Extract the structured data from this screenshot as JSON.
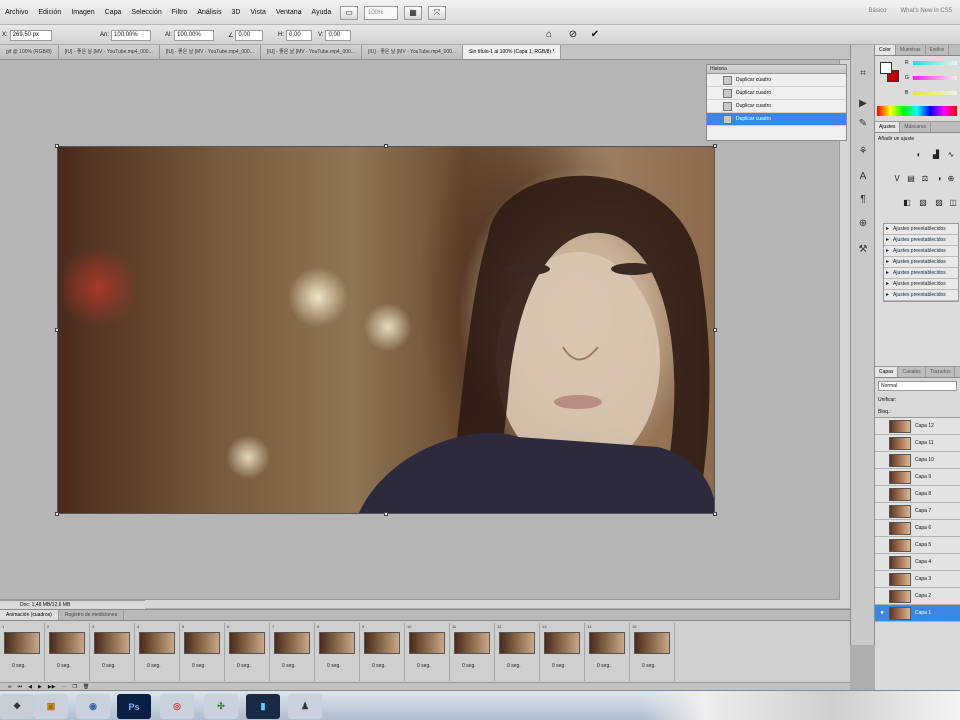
{
  "menubar": {
    "items": [
      "Archivo",
      "Edición",
      "Imagen",
      "Capa",
      "Selección",
      "Filtro",
      "Análisis",
      "3D",
      "Vista",
      "Ventana",
      "Ayuda"
    ],
    "zoom": "100%",
    "workspace": [
      "Básico",
      "What's New in CS5"
    ]
  },
  "options": {
    "x_label": "X:",
    "x_value": "269,50 px",
    "w_label": "An:",
    "w_value": "100,00%",
    "h_label": "Al:",
    "h_value": "100,00%",
    "angle_label": "∠",
    "angle_value": "0,00",
    "h_skew_label": "H:",
    "h_skew_value": "0,00",
    "v_skew_label": "V:",
    "v_skew_value": "0,00"
  },
  "doc_tabs": [
    "gif @ 100% (RGB/8)",
    "[IU] - 좋은 날 [MV - YouTube.mp4_000...",
    "[IU] - 좋은 날 [MV - YouTube.mp4_000...",
    "[IU] - 좋은 날 [MV - YouTube.mp4_000...",
    "[IU] - 좋은 날 [MV - YouTube.mp4_000...",
    "Sin título-1 al 100% (Capa 1, RGB/8) *"
  ],
  "history": {
    "title": "Historia",
    "items": [
      "Duplicar cuadro",
      "Duplicar cuadro",
      "Duplicar cuadro",
      "Duplicar cuadro"
    ]
  },
  "status": "Doc: 1,48 MB/12,6 MB",
  "color_panel": {
    "tabs": [
      "Color",
      "Muestras",
      "Estilos"
    ],
    "slider_labels": [
      "R",
      "G",
      "B"
    ]
  },
  "adjust_panel": {
    "tabs": [
      "Ajustes",
      "Máscaras"
    ],
    "title": "Añadir un ajuste",
    "presets": [
      "Ajustes preestablecidos",
      "Ajustes preestablecidos",
      "Ajustes preestablecidos",
      "Ajustes preestablecidos",
      "Ajustes preestablecidos",
      "Ajustes preestablecidos",
      "Ajustes preestablecidos"
    ]
  },
  "layers_panel": {
    "tabs": [
      "Capas",
      "Canales",
      "Trazados"
    ],
    "blend_mode": "Normal",
    "unify_label": "Unificar:",
    "lock_label": "Bloq.:",
    "layers": [
      "Capa 12",
      "Capa 11",
      "Capa 10",
      "Capa 9",
      "Capa 8",
      "Capa 7",
      "Capa 6",
      "Capa 5",
      "Capa 4",
      "Capa 3",
      "Capa 2",
      "Capa 1"
    ]
  },
  "animation": {
    "tabs": [
      "Animación (cuadros)",
      "Registro de mediciones"
    ],
    "frames": [
      "1",
      "2",
      "3",
      "4",
      "5",
      "6",
      "7",
      "8",
      "9",
      "10",
      "11",
      "12",
      "13",
      "14",
      "15"
    ],
    "delay": "0 seg."
  },
  "taskbar": {
    "apps": [
      "start-icon",
      "explorer-icon",
      "media-player-icon",
      "vlc-icon",
      "photoshop-icon",
      "chrome-icon",
      "network-icon",
      "lightroom-icon",
      "app-icon"
    ],
    "ps_label": "Ps"
  },
  "colors": {
    "accent": "#3d86e6",
    "foreground_swatch": "#ffffff",
    "background_swatch": "#c00000"
  }
}
